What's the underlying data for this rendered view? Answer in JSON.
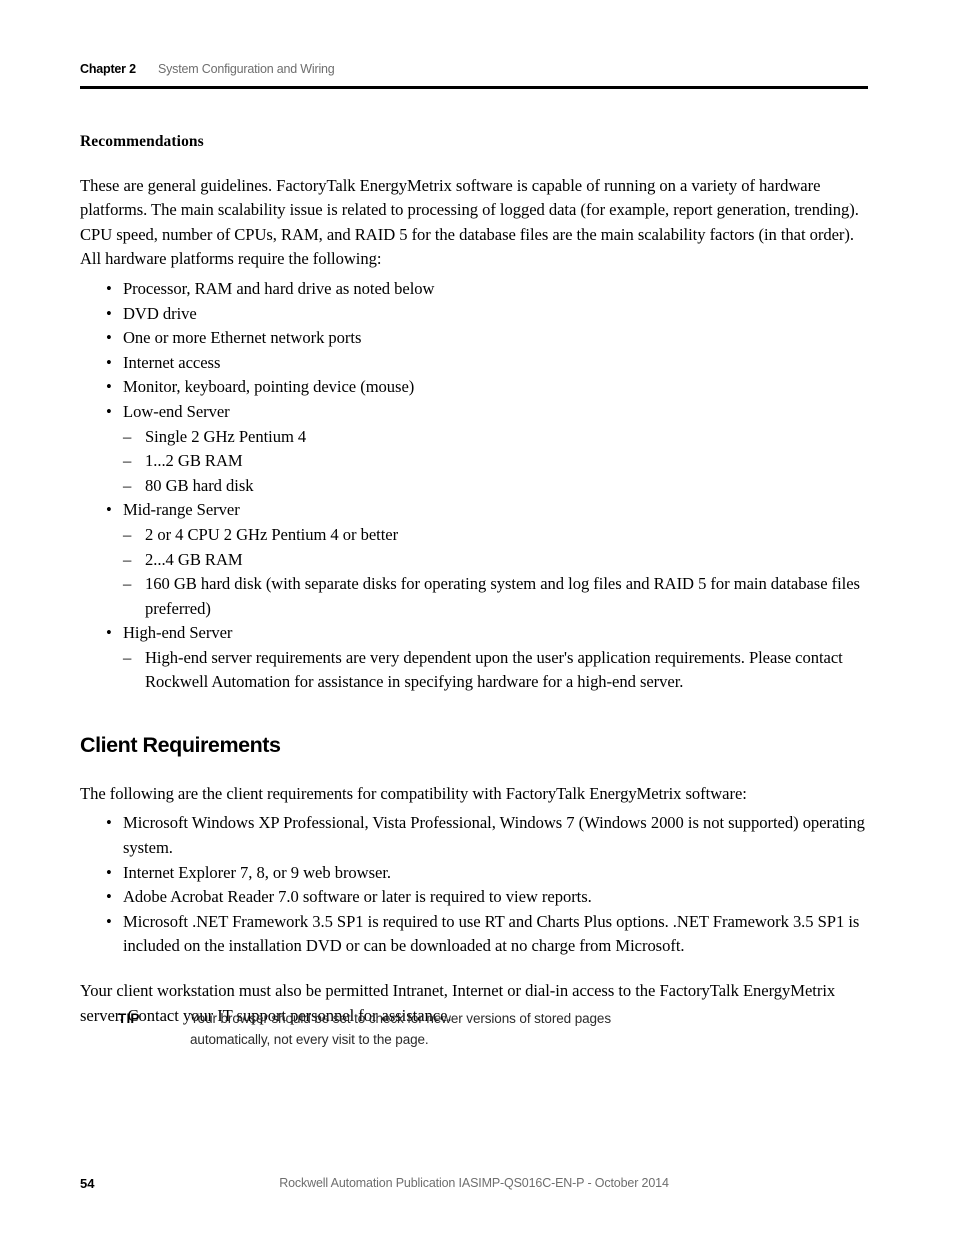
{
  "header": {
    "chapter": "Chapter 2",
    "title": "System Configuration and Wiring"
  },
  "recommendations": {
    "subhead": "Recommendations",
    "intro": "These are general guidelines. FactoryTalk EnergyMetrix software is capable of running on a variety of hardware platforms. The main scalability issue is related to processing of logged data (for example, report generation, trending). CPU speed, number of CPUs, RAM, and RAID 5 for the database files are the main scalability factors (in that order). All hardware platforms require the following:",
    "bullets": [
      {
        "text": "Processor, RAM and hard drive as noted below"
      },
      {
        "text": "DVD drive"
      },
      {
        "text": "One or more Ethernet network ports"
      },
      {
        "text": "Internet access"
      },
      {
        "text": "Monitor, keyboard, pointing device (mouse)"
      },
      {
        "text": "Low-end Server",
        "sub": [
          "Single 2 GHz Pentium 4",
          "1...2 GB RAM",
          "80 GB hard disk"
        ]
      },
      {
        "text": "Mid-range Server",
        "sub": [
          "2 or 4 CPU 2 GHz Pentium 4 or better",
          "2...4 GB RAM",
          "160 GB hard disk (with separate disks for operating system and log files and RAID 5 for main database files preferred)"
        ]
      },
      {
        "text": "High-end Server",
        "sub": [
          "High-end server requirements are very dependent upon the user's application requirements. Please contact Rockwell Automation for assistance in specifying hardware for a high-end server."
        ]
      }
    ]
  },
  "client_requirements": {
    "heading": "Client Requirements",
    "intro": "The following are the client requirements for compatibility with FactoryTalk EnergyMetrix software:",
    "bullets": [
      "Microsoft Windows XP Professional, Vista Professional, Windows 7 (Windows 2000 is not supported) operating system.",
      "Internet Explorer 7, 8, or 9 web browser.",
      "Adobe Acrobat Reader 7.0 software or later is required to view reports.",
      "Microsoft .NET Framework 3.5 SP1 is required to use RT and Charts Plus options. .NET Framework 3.5 SP1 is included on the installation DVD or can be downloaded at no charge from Microsoft."
    ],
    "closing": "Your client workstation must also be permitted Intranet, Internet or dial-in access to the FactoryTalk EnergyMetrix server. Contact your IT support personnel for assistance."
  },
  "tip": {
    "label": "TIP",
    "text": "Your browser should be set to check for newer versions of stored pages automatically, not every visit to the page."
  },
  "footer": {
    "page_number": "54",
    "publication": "Rockwell Automation Publication IASIMP-QS016C-EN-P - October 2014"
  },
  "glyphs": {
    "bullet": "•",
    "dash": "–"
  }
}
